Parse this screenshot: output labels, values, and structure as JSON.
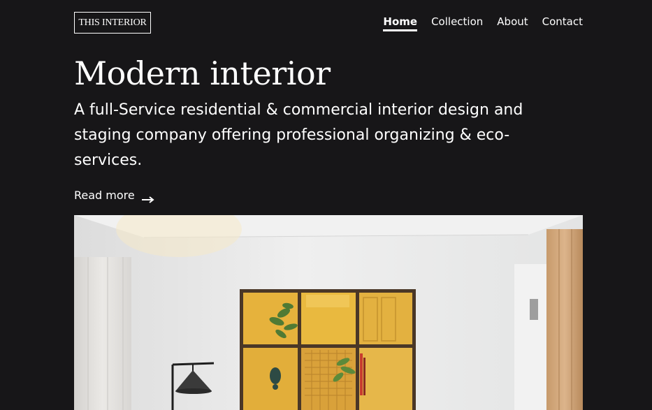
{
  "brand": {
    "logo_text": "THIS INTERIOR"
  },
  "nav": {
    "items": [
      {
        "label": "Home",
        "active": true
      },
      {
        "label": "Collection",
        "active": false
      },
      {
        "label": "About",
        "active": false
      },
      {
        "label": "Contact",
        "active": false
      }
    ]
  },
  "hero": {
    "title": "Modern interior",
    "subtitle": "A full-Service residential & commercial interior design and staging company offering professional organizing & eco-services.",
    "cta_label": "Read more",
    "cta_icon": "arrow-right-icon"
  },
  "colors": {
    "background": "#171618",
    "text": "#ffffff",
    "accent_yellow": "#e7b73a"
  }
}
